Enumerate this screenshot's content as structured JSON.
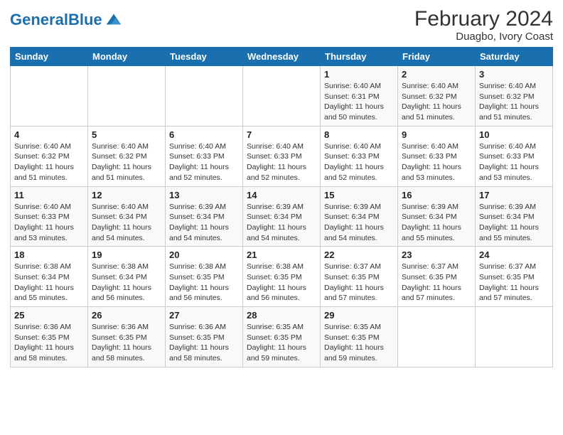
{
  "header": {
    "logo_general": "General",
    "logo_blue": "Blue",
    "title": "February 2024",
    "subtitle": "Duagbo, Ivory Coast"
  },
  "days_of_week": [
    "Sunday",
    "Monday",
    "Tuesday",
    "Wednesday",
    "Thursday",
    "Friday",
    "Saturday"
  ],
  "weeks": [
    [
      {
        "day": "",
        "info": ""
      },
      {
        "day": "",
        "info": ""
      },
      {
        "day": "",
        "info": ""
      },
      {
        "day": "",
        "info": ""
      },
      {
        "day": "1",
        "info": "Sunrise: 6:40 AM\nSunset: 6:31 PM\nDaylight: 11 hours and 50 minutes."
      },
      {
        "day": "2",
        "info": "Sunrise: 6:40 AM\nSunset: 6:32 PM\nDaylight: 11 hours and 51 minutes."
      },
      {
        "day": "3",
        "info": "Sunrise: 6:40 AM\nSunset: 6:32 PM\nDaylight: 11 hours and 51 minutes."
      }
    ],
    [
      {
        "day": "4",
        "info": "Sunrise: 6:40 AM\nSunset: 6:32 PM\nDaylight: 11 hours and 51 minutes."
      },
      {
        "day": "5",
        "info": "Sunrise: 6:40 AM\nSunset: 6:32 PM\nDaylight: 11 hours and 51 minutes."
      },
      {
        "day": "6",
        "info": "Sunrise: 6:40 AM\nSunset: 6:33 PM\nDaylight: 11 hours and 52 minutes."
      },
      {
        "day": "7",
        "info": "Sunrise: 6:40 AM\nSunset: 6:33 PM\nDaylight: 11 hours and 52 minutes."
      },
      {
        "day": "8",
        "info": "Sunrise: 6:40 AM\nSunset: 6:33 PM\nDaylight: 11 hours and 52 minutes."
      },
      {
        "day": "9",
        "info": "Sunrise: 6:40 AM\nSunset: 6:33 PM\nDaylight: 11 hours and 53 minutes."
      },
      {
        "day": "10",
        "info": "Sunrise: 6:40 AM\nSunset: 6:33 PM\nDaylight: 11 hours and 53 minutes."
      }
    ],
    [
      {
        "day": "11",
        "info": "Sunrise: 6:40 AM\nSunset: 6:33 PM\nDaylight: 11 hours and 53 minutes."
      },
      {
        "day": "12",
        "info": "Sunrise: 6:40 AM\nSunset: 6:34 PM\nDaylight: 11 hours and 54 minutes."
      },
      {
        "day": "13",
        "info": "Sunrise: 6:39 AM\nSunset: 6:34 PM\nDaylight: 11 hours and 54 minutes."
      },
      {
        "day": "14",
        "info": "Sunrise: 6:39 AM\nSunset: 6:34 PM\nDaylight: 11 hours and 54 minutes."
      },
      {
        "day": "15",
        "info": "Sunrise: 6:39 AM\nSunset: 6:34 PM\nDaylight: 11 hours and 54 minutes."
      },
      {
        "day": "16",
        "info": "Sunrise: 6:39 AM\nSunset: 6:34 PM\nDaylight: 11 hours and 55 minutes."
      },
      {
        "day": "17",
        "info": "Sunrise: 6:39 AM\nSunset: 6:34 PM\nDaylight: 11 hours and 55 minutes."
      }
    ],
    [
      {
        "day": "18",
        "info": "Sunrise: 6:38 AM\nSunset: 6:34 PM\nDaylight: 11 hours and 55 minutes."
      },
      {
        "day": "19",
        "info": "Sunrise: 6:38 AM\nSunset: 6:34 PM\nDaylight: 11 hours and 56 minutes."
      },
      {
        "day": "20",
        "info": "Sunrise: 6:38 AM\nSunset: 6:35 PM\nDaylight: 11 hours and 56 minutes."
      },
      {
        "day": "21",
        "info": "Sunrise: 6:38 AM\nSunset: 6:35 PM\nDaylight: 11 hours and 56 minutes."
      },
      {
        "day": "22",
        "info": "Sunrise: 6:37 AM\nSunset: 6:35 PM\nDaylight: 11 hours and 57 minutes."
      },
      {
        "day": "23",
        "info": "Sunrise: 6:37 AM\nSunset: 6:35 PM\nDaylight: 11 hours and 57 minutes."
      },
      {
        "day": "24",
        "info": "Sunrise: 6:37 AM\nSunset: 6:35 PM\nDaylight: 11 hours and 57 minutes."
      }
    ],
    [
      {
        "day": "25",
        "info": "Sunrise: 6:36 AM\nSunset: 6:35 PM\nDaylight: 11 hours and 58 minutes."
      },
      {
        "day": "26",
        "info": "Sunrise: 6:36 AM\nSunset: 6:35 PM\nDaylight: 11 hours and 58 minutes."
      },
      {
        "day": "27",
        "info": "Sunrise: 6:36 AM\nSunset: 6:35 PM\nDaylight: 11 hours and 58 minutes."
      },
      {
        "day": "28",
        "info": "Sunrise: 6:35 AM\nSunset: 6:35 PM\nDaylight: 11 hours and 59 minutes."
      },
      {
        "day": "29",
        "info": "Sunrise: 6:35 AM\nSunset: 6:35 PM\nDaylight: 11 hours and 59 minutes."
      },
      {
        "day": "",
        "info": ""
      },
      {
        "day": "",
        "info": ""
      }
    ]
  ]
}
